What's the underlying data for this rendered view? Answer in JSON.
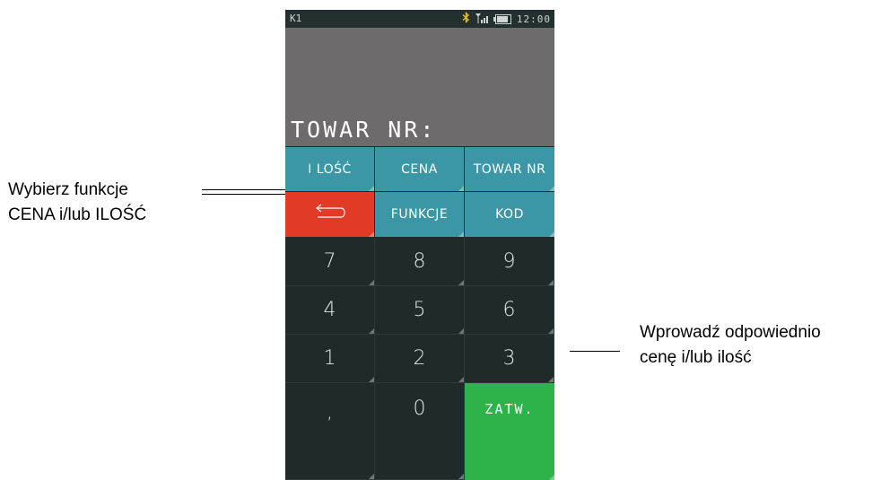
{
  "annotations": {
    "left_line1": "Wybierz funkcje",
    "left_line2": "CENA i/lub ILOŚĆ",
    "right_line1": "Wprowadź odpowiednio",
    "right_line2": "cenę i/lub ilość"
  },
  "statusbar": {
    "mode": "K1",
    "bluetooth_icon": "bluetooth-icon",
    "signal_icon": "signal-icon",
    "battery_level": 0.85,
    "time": "12:00"
  },
  "display": {
    "prompt": "TOWAR NR:"
  },
  "keypad": {
    "function_row1": [
      "I LOŚĆ",
      "CENA",
      "TOWAR NR"
    ],
    "back_icon": "back-arrow-icon",
    "function_row2": [
      "FUNKCJE",
      "KOD"
    ],
    "digits": [
      "7",
      "8",
      "9",
      "4",
      "5",
      "6",
      "1",
      "2",
      "3"
    ],
    "comma": ",",
    "zero": "0",
    "confirm": "ZATW."
  },
  "colors": {
    "teal_key": "#3b97a6",
    "dark_key": "#1f2b2b",
    "back_key": "#e13a27",
    "confirm_key": "#2db34a",
    "display_bg": "#6d6b6b",
    "bluetooth": "#f2c500"
  }
}
